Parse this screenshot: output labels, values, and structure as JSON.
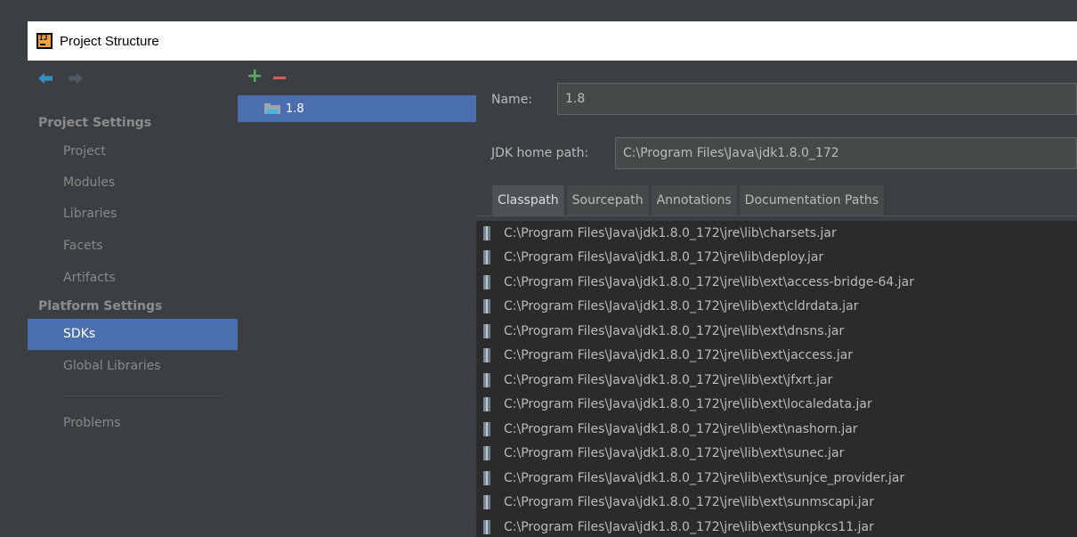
{
  "window": {
    "title": "Project Structure"
  },
  "sidebar": {
    "project_settings_header": "Project Settings",
    "platform_settings_header": "Platform Settings",
    "items": [
      {
        "label": "Project"
      },
      {
        "label": "Modules"
      },
      {
        "label": "Libraries"
      },
      {
        "label": "Facets"
      },
      {
        "label": "Artifacts"
      },
      {
        "label": "SDKs",
        "selected": true
      },
      {
        "label": "Global Libraries"
      },
      {
        "label": "Problems"
      }
    ]
  },
  "sdk_list": {
    "items": [
      {
        "label": "1.8",
        "selected": true
      }
    ]
  },
  "details": {
    "name_label": "Name:",
    "name_value": "1.8",
    "jdk_home_label": "JDK home path:",
    "jdk_home_value": "C:\\Program Files\\Java\\jdk1.8.0_172",
    "tabs": [
      {
        "label": "Classpath",
        "active": true
      },
      {
        "label": "Sourcepath"
      },
      {
        "label": "Annotations"
      },
      {
        "label": "Documentation Paths"
      }
    ],
    "classpath": [
      "C:\\Program Files\\Java\\jdk1.8.0_172\\jre\\lib\\charsets.jar",
      "C:\\Program Files\\Java\\jdk1.8.0_172\\jre\\lib\\deploy.jar",
      "C:\\Program Files\\Java\\jdk1.8.0_172\\jre\\lib\\ext\\access-bridge-64.jar",
      "C:\\Program Files\\Java\\jdk1.8.0_172\\jre\\lib\\ext\\cldrdata.jar",
      "C:\\Program Files\\Java\\jdk1.8.0_172\\jre\\lib\\ext\\dnsns.jar",
      "C:\\Program Files\\Java\\jdk1.8.0_172\\jre\\lib\\ext\\jaccess.jar",
      "C:\\Program Files\\Java\\jdk1.8.0_172\\jre\\lib\\ext\\jfxrt.jar",
      "C:\\Program Files\\Java\\jdk1.8.0_172\\jre\\lib\\ext\\localedata.jar",
      "C:\\Program Files\\Java\\jdk1.8.0_172\\jre\\lib\\ext\\nashorn.jar",
      "C:\\Program Files\\Java\\jdk1.8.0_172\\jre\\lib\\ext\\sunec.jar",
      "C:\\Program Files\\Java\\jdk1.8.0_172\\jre\\lib\\ext\\sunjce_provider.jar",
      "C:\\Program Files\\Java\\jdk1.8.0_172\\jre\\lib\\ext\\sunmscapi.jar",
      "C:\\Program Files\\Java\\jdk1.8.0_172\\jre\\lib\\ext\\sunpkcs11.jar"
    ]
  },
  "colors": {
    "selection": "#4b6eaf",
    "add_green": "#59a869",
    "remove_red": "#db5c5c",
    "nav_blue": "#3592c4"
  }
}
